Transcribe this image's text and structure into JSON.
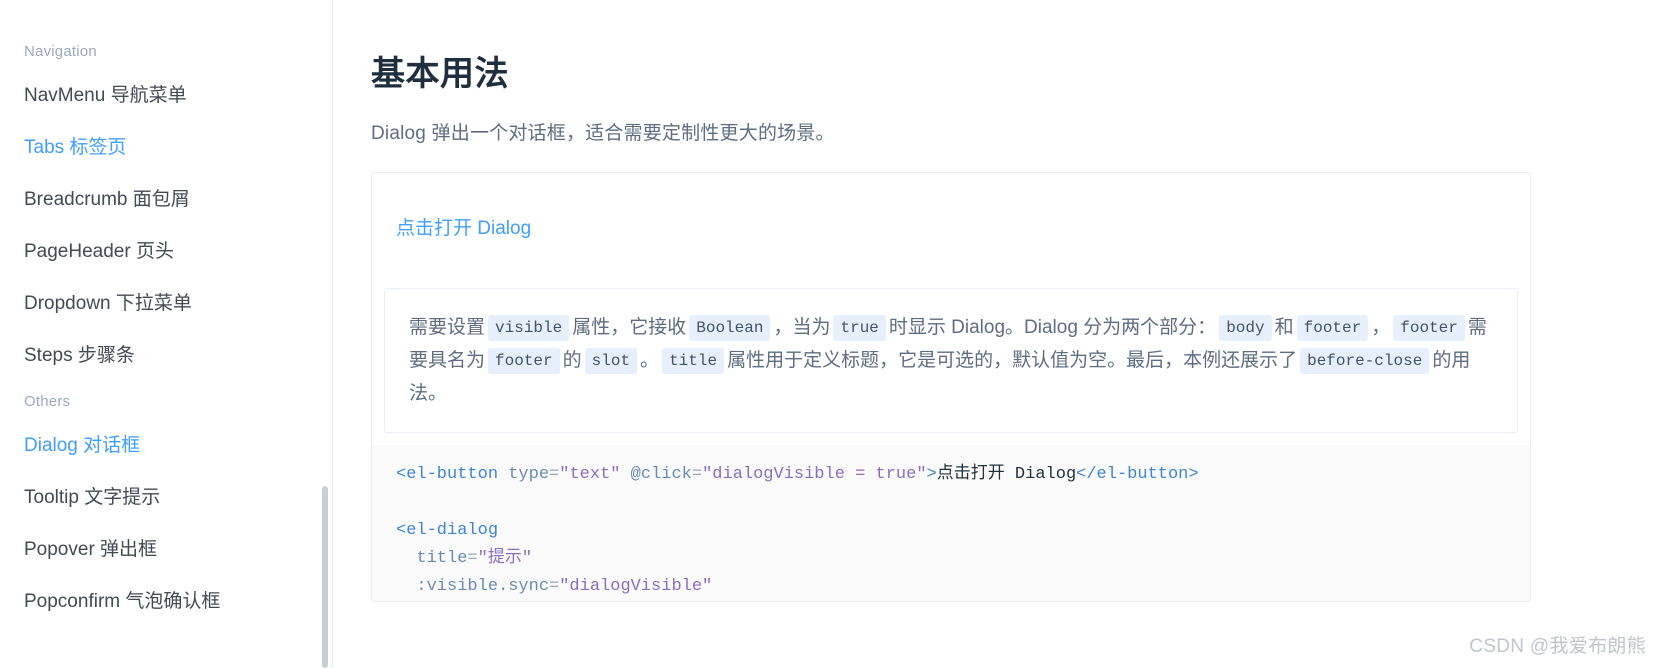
{
  "sidebar": {
    "groups": [
      {
        "title": "Navigation",
        "items": [
          {
            "label": "NavMenu 导航菜单",
            "active": false
          },
          {
            "label": "Tabs 标签页",
            "active": true
          },
          {
            "label": "Breadcrumb 面包屑",
            "active": false
          },
          {
            "label": "PageHeader 页头",
            "active": false
          },
          {
            "label": "Dropdown 下拉菜单",
            "active": false
          },
          {
            "label": "Steps 步骤条",
            "active": false
          }
        ]
      },
      {
        "title": "Others",
        "items": [
          {
            "label": "Dialog 对话框",
            "active": true
          },
          {
            "label": "Tooltip 文字提示",
            "active": false
          },
          {
            "label": "Popover 弹出框",
            "active": false
          },
          {
            "label": "Popconfirm 气泡确认框",
            "active": false
          }
        ]
      }
    ],
    "scrollbar": "vertical-scrollbar"
  },
  "main": {
    "title": "基本用法",
    "description": "Dialog 弹出一个对话框，适合需要定制性更大的场景。",
    "demo": {
      "button_label": "点击打开 Dialog"
    },
    "meta": {
      "text_1": "需要设置",
      "code_1": "visible",
      "text_2": "属性，它接收",
      "code_2": "Boolean",
      "text_3": "，当为",
      "code_3": "true",
      "text_4": "时显示 Dialog。Dialog 分为两个部分：",
      "code_4": "body",
      "text_5": "和",
      "code_5": "footer",
      "text_6": "，",
      "code_6": "footer",
      "text_7": "需要具名为",
      "code_7": "footer",
      "text_8": "的",
      "code_8": "slot",
      "text_9": "。",
      "code_9": "title",
      "text_10": "属性用于定义标题，它是可选的，默认值为空。最后，本例还展示了",
      "code_10": "before-close",
      "text_11": "的用法。"
    },
    "code": {
      "line1": {
        "tag_open": "<el-button",
        "attr1": "type",
        "eq1": "=",
        "str1": "\"text\"",
        "attr2": "@click",
        "eq2": "=",
        "str2": "\"dialogVisible = true\"",
        "gt": ">",
        "text": "点击打开 Dialog",
        "tag_close": "</el-button>"
      },
      "line2": {
        "tag_open": "<el-dialog"
      },
      "line3": {
        "attr": "title",
        "eq": "=",
        "str": "\"提示\""
      },
      "line4": {
        "attr": ":visible.sync",
        "eq": "=",
        "str": "\"dialogVisible\""
      }
    }
  },
  "watermark": "CSDN @我爱布朗熊",
  "colors": {
    "accent": "#409eff",
    "title": "#1f2f3d",
    "body_text": "#5e6d82",
    "muted": "#99a9bf",
    "code_chip_bg": "#e6effb",
    "code_block_bg": "#fafafa",
    "border": "#ebebeb"
  }
}
